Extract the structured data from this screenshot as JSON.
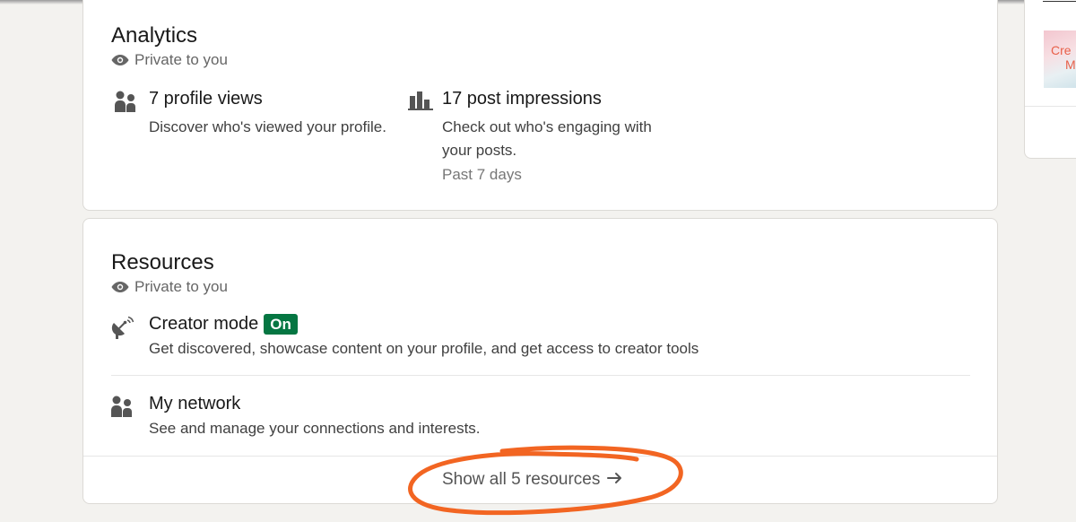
{
  "analytics": {
    "title": "Analytics",
    "visibility": "Private to you",
    "metrics": [
      {
        "icon": "people-icon",
        "title": "7 profile views",
        "description": "Discover who's viewed your profile."
      },
      {
        "icon": "bar-chart-icon",
        "title": "17 post impressions",
        "description": "Check out who's engaging with your posts.",
        "subtext": "Past 7 days"
      }
    ]
  },
  "resources": {
    "title": "Resources",
    "visibility": "Private to you",
    "items": [
      {
        "icon": "satellite-dish-icon",
        "title": "Creator mode",
        "badge": "On",
        "description": "Get discovered, showcase content on your profile, and get access to creator tools"
      },
      {
        "icon": "people-icon",
        "title": "My network",
        "description": "See and manage your connections and interests."
      }
    ],
    "show_all_label": "Show all 5 resources",
    "show_all_icon": "arrow-right-icon"
  },
  "sidebar_ad": {
    "thumb_text_1": "Cre",
    "thumb_text_2": "M"
  },
  "colors": {
    "badge_green": "#057642",
    "annotation_orange": "#f26522",
    "page_background": "#f3f2ef"
  }
}
